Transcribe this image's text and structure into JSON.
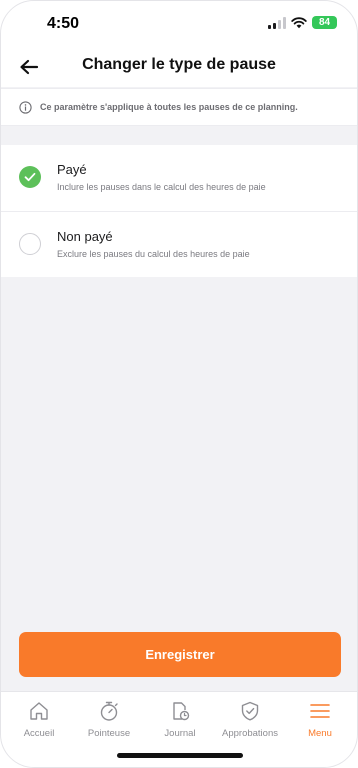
{
  "status_bar": {
    "time": "4:50",
    "battery": "84"
  },
  "header": {
    "title": "Changer le type de pause"
  },
  "info_banner": {
    "text": "Ce paramètre s'applique à toutes les pauses de ce planning."
  },
  "options": [
    {
      "label": "Payé",
      "description": "Inclure les pauses dans le calcul des heures de paie",
      "selected": true
    },
    {
      "label": "Non payé",
      "description": "Exclure les pauses du calcul des heures de paie",
      "selected": false
    }
  ],
  "save_button": {
    "label": "Enregistrer"
  },
  "tab_bar": {
    "items": [
      {
        "label": "Accueil",
        "icon": "home-icon",
        "active": false
      },
      {
        "label": "Pointeuse",
        "icon": "stopwatch-icon",
        "active": false
      },
      {
        "label": "Journal",
        "icon": "timesheet-icon",
        "active": false
      },
      {
        "label": "Approbations",
        "icon": "shield-check-icon",
        "active": false
      },
      {
        "label": "Menu",
        "icon": "menu-icon",
        "active": true
      }
    ]
  },
  "colors": {
    "accent": "#f97a2a",
    "selected_radio": "#5dc05a",
    "battery": "#34c759"
  }
}
